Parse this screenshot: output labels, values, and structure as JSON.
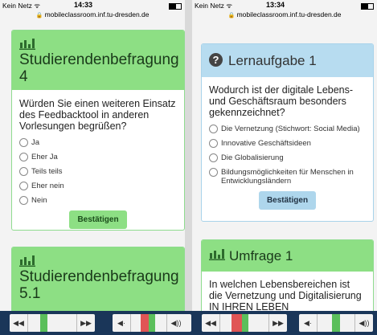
{
  "left": {
    "status": {
      "carrier": "Kein Netz ᯤ",
      "time": "14:33"
    },
    "url": "mobileclassroom.inf.tu-dresden.de",
    "survey1": {
      "title": "Studierendenbefragung 4",
      "question": "Würden Sie einen weiteren Einsatz des Feedbacktool in anderen Vorlesungen begrüßen?",
      "options": [
        "Ja",
        "Eher Ja",
        "Teils teils",
        "Eher nein",
        "Nein"
      ],
      "confirm_label": "Bestätigen"
    },
    "survey2": {
      "title": "Studierendenbefragung 5.1"
    }
  },
  "right": {
    "status": {
      "carrier": "Kein Netz ᯤ",
      "time": "13:34"
    },
    "url": "mobileclassroom.inf.tu-dresden.de",
    "task": {
      "title": "Lernaufgabe 1",
      "question": "Wodurch ist der digitale Lebens- und Geschäftsraum besonders gekennzeichnet?",
      "options": [
        "Die Vernetzung (Stichwort: Social Media)",
        "Innovative Geschäftsideen",
        "Die Globalisierung",
        "Bildungsmöglichkeiten für Menschen in Entwicklungsländern"
      ],
      "confirm_label": "Bestätigen"
    },
    "poll": {
      "title": "Umfrage 1",
      "question": "In welchen Lebensbereichen ist die Vernetzung und Digitalisierung IN IHREN LEBEN"
    }
  },
  "toolbar": {
    "rewind_glyph": "◀◀",
    "forward_glyph": "▶▶",
    "vol_down_glyph": "◀·",
    "vol_up_glyph": "◀))",
    "colors": {
      "bg": "#1a3659",
      "red": "#e05555",
      "green": "#5bbf5b",
      "light": "#f2f2f2"
    }
  }
}
